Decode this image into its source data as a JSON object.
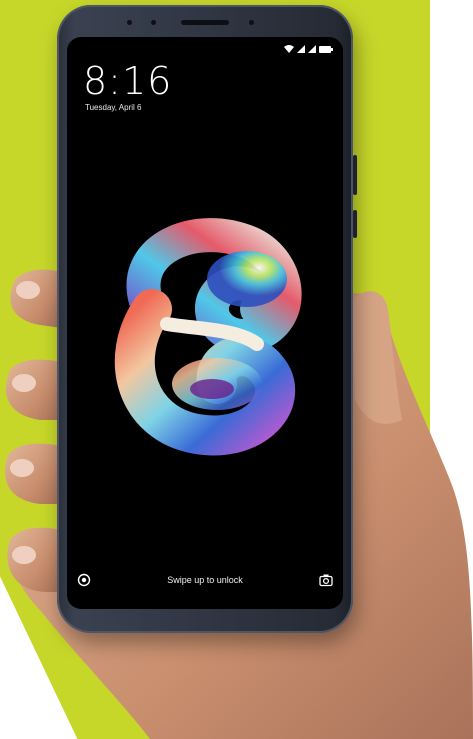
{
  "lockscreen": {
    "time": "8:16",
    "date": "Tuesday, April 6",
    "unlock_hint": "Swipe up to unlock"
  },
  "icons": {
    "wallpaper": "swirl-s-wallpaper",
    "left_shortcut": "circle-dot-icon",
    "right_shortcut": "camera-icon",
    "status": [
      "wifi-icon",
      "signal-icon",
      "signal-icon",
      "battery-icon"
    ]
  },
  "colors": {
    "background_accent": "#c7d72a",
    "phone_body": "#2a2f3a",
    "screen": "#000000"
  }
}
